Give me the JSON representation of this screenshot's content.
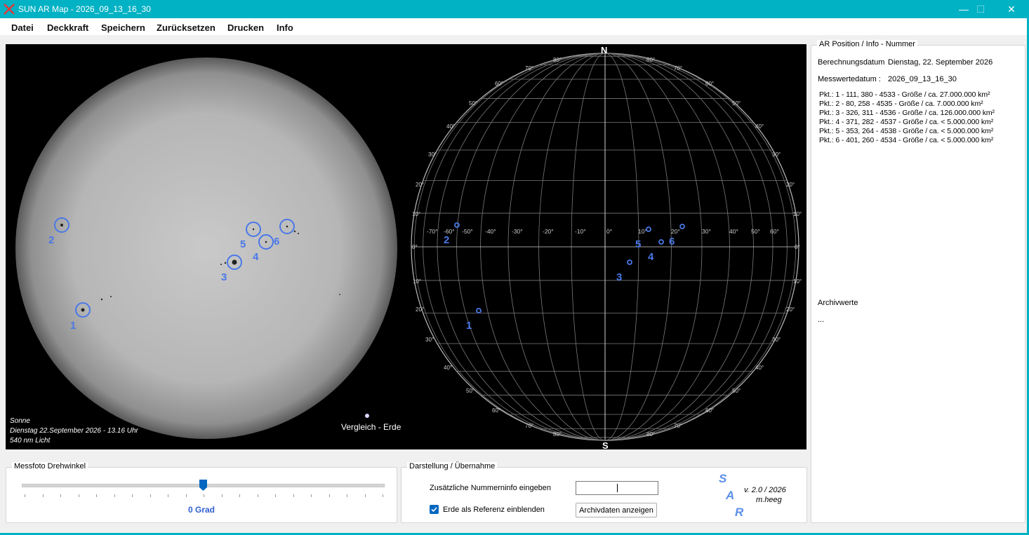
{
  "window": {
    "title": "SUN AR Map - 2026_09_13_16_30",
    "colors": {
      "titlebar": "#00b2c4",
      "accent": "#5b8fe8"
    },
    "controls": {
      "minimize": "—",
      "maximize": "☐",
      "close": "✕"
    }
  },
  "menu": [
    "Datei",
    "Deckkraft",
    "Speichern",
    "Zurücksetzen",
    "Drucken",
    "Info"
  ],
  "photo": {
    "caption_title": "Sonne",
    "caption_date": "Dienstag 22.September 2026 - 13.16 Uhr",
    "caption_light": "540 nm Licht",
    "compare_label": "Vergleich - Erde",
    "markers": [
      "1",
      "2",
      "3",
      "4",
      "5",
      "6"
    ]
  },
  "grid": {
    "north": "N",
    "south": "S",
    "longitude_labels": [
      "-70°",
      "-60°",
      "-50°",
      "-40°",
      "-30°",
      "-20°",
      "-10°",
      "0°",
      "10°",
      "20°",
      "30°",
      "40°",
      "50°",
      "60°"
    ],
    "latitude_labels": [
      "80°",
      "70°",
      "60°",
      "50°",
      "40°",
      "30°",
      "20°",
      "10°",
      "0°"
    ],
    "point_labels": [
      "1",
      "2",
      "3",
      "4",
      "5",
      "6"
    ]
  },
  "info": {
    "legend": "AR Position / Info - Nummer",
    "calc_label": "Berechnungsdatum",
    "calc_value": "Dienstag, 22. September 2026",
    "meas_label": "Messwertedatum  :",
    "meas_value": "2026_09_13_16_30",
    "points": [
      "Pkt.: 1 - 111, 380 - 4533 -  Größe / ca. 27.000.000 km²",
      "Pkt.: 2 - 80, 258 - 4535 -  Größe / ca. 7.000.000 km²",
      "Pkt.: 3 - 326, 311 - 4536 -  Größe / ca. 126.000.000 km²",
      "Pkt.: 4 - 371, 282 - 4537 -  Größe / ca. < 5.000.000 km²",
      "Pkt.: 5 - 353, 264 - 4538 -  Größe / ca. < 5.000.000 km²",
      "Pkt.: 6 - 401, 260 - 4534 -  Größe / ca. < 5.000.000 km²"
    ],
    "archive_label": "Archivwerte",
    "archive_value": "..."
  },
  "rotation": {
    "legend": "Messfoto Drehwinkel",
    "value_label": "0 Grad",
    "slider_fraction": 0.5
  },
  "display": {
    "legend": "Darstellung / Übernahme",
    "extra_label": "Zusätzliche Nummerninfo eingeben",
    "extra_value": "",
    "earth_checkbox_label": "Erde als Referenz einblenden",
    "earth_checked": true,
    "archive_button": "Archivdaten anzeigen",
    "sar": [
      "S",
      "A",
      "R"
    ],
    "version": "v. 2.0 / 2026",
    "author": "m.heeg"
  }
}
